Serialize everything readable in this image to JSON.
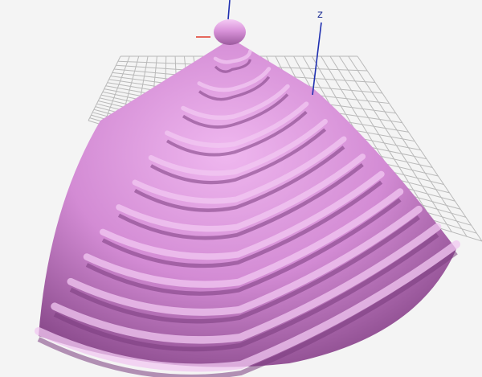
{
  "viewport": {
    "axis_label_z": "z",
    "shape_color": "#d58fd6",
    "shape_shadow_color": "#7a3d7d",
    "shape_highlight_color": "#f2c8f2",
    "grid_color": "#b9b9b9",
    "background_color": "#f4f4f4",
    "z_axis_color": "#1f2fb0",
    "x_axis_color": "#e03a2a"
  }
}
